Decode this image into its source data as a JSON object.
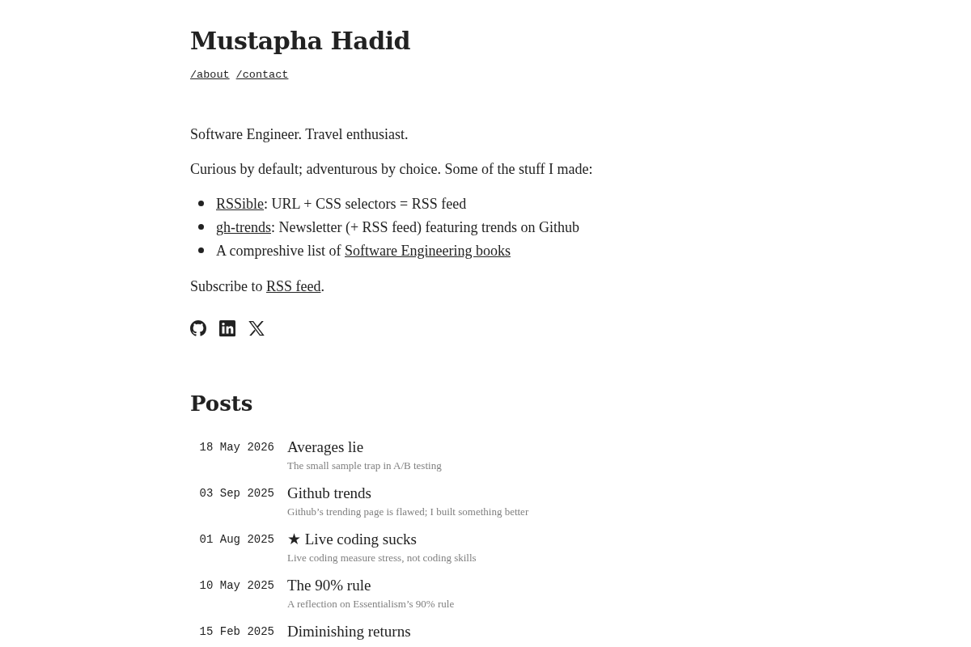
{
  "header": {
    "title": "Mustapha Hadid",
    "nav": [
      {
        "label": "/about"
      },
      {
        "label": "/contact"
      }
    ]
  },
  "intro": [
    "Software Engineer. Travel enthusiast.",
    "Curious by default; adventurous by choice. Some of the stuff I made:"
  ],
  "projects": [
    {
      "parts": [
        {
          "kind": "link",
          "text": "RSSible"
        },
        {
          "kind": "plain",
          "text": ": URL + CSS selectors = RSS feed"
        }
      ]
    },
    {
      "parts": [
        {
          "kind": "link",
          "text": "gh-trends"
        },
        {
          "kind": "plain",
          "text": ": Newsletter (+ RSS feed) featuring trends on Github"
        }
      ]
    },
    {
      "parts": [
        {
          "kind": "plain",
          "text": "A compreshive list of "
        },
        {
          "kind": "link",
          "text": "Software Engineering books"
        }
      ]
    }
  ],
  "subscribe": {
    "parts": [
      {
        "kind": "plain",
        "text": "Subscribe to "
      },
      {
        "kind": "link",
        "text": "RSS feed"
      },
      {
        "kind": "plain",
        "text": "."
      }
    ]
  },
  "posts": {
    "heading": "Posts",
    "items": [
      {
        "date": "18 May 2026",
        "title": "Averages lie",
        "summary": "The small sample trap in A/B testing"
      },
      {
        "date": "03 Sep 2025",
        "title": "Github trends",
        "summary": "Github’s trending page is flawed; I built something better"
      },
      {
        "date": "01 Aug 2025",
        "title": "★ Live coding sucks",
        "summary": "Live coding measure stress, not coding skills"
      },
      {
        "date": "10 May 2025",
        "title": "The 90% rule",
        "summary": "A reflection on Essentialism’s 90% rule"
      },
      {
        "date": "15 Feb 2025",
        "title": "Diminishing returns"
      }
    ]
  }
}
